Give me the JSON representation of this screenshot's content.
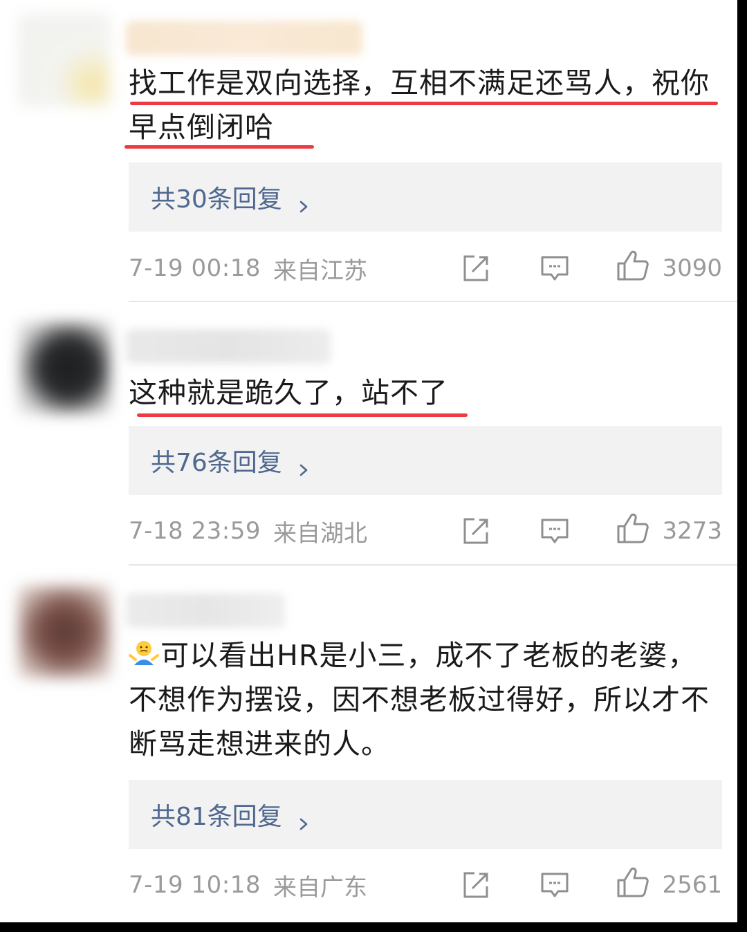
{
  "comments": [
    {
      "text": "找工作是双向选择，互相不满足还骂人，祝你早点倒闭哈",
      "replies_label": "共30条回复",
      "time": "7-19 00:18",
      "location": "来自江苏",
      "likes": "3090"
    },
    {
      "text": "这种就是跪久了，站不了",
      "replies_label": "共76条回复",
      "time": "7-18 23:59",
      "location": "来自湖北",
      "likes": "3273"
    },
    {
      "text": "可以看出HR是小三，成不了老板的老婆，不想作为摆设，因不想老板过得好，所以才不断骂走想进来的人。",
      "emoji": "shrug-emoji",
      "replies_label": "共81条回复",
      "time": "7-19 10:18",
      "location": "来自广东",
      "likes": "2561"
    }
  ],
  "icons": {
    "share": "share-icon",
    "reply": "comment-icon",
    "like": "thumbs-up-icon",
    "chevron": "chevron-right-icon"
  },
  "colors": {
    "underline": "#ee3a43",
    "link": "#50688f",
    "meta": "#9a9a9a",
    "reply_bg": "#f2f2f2"
  }
}
